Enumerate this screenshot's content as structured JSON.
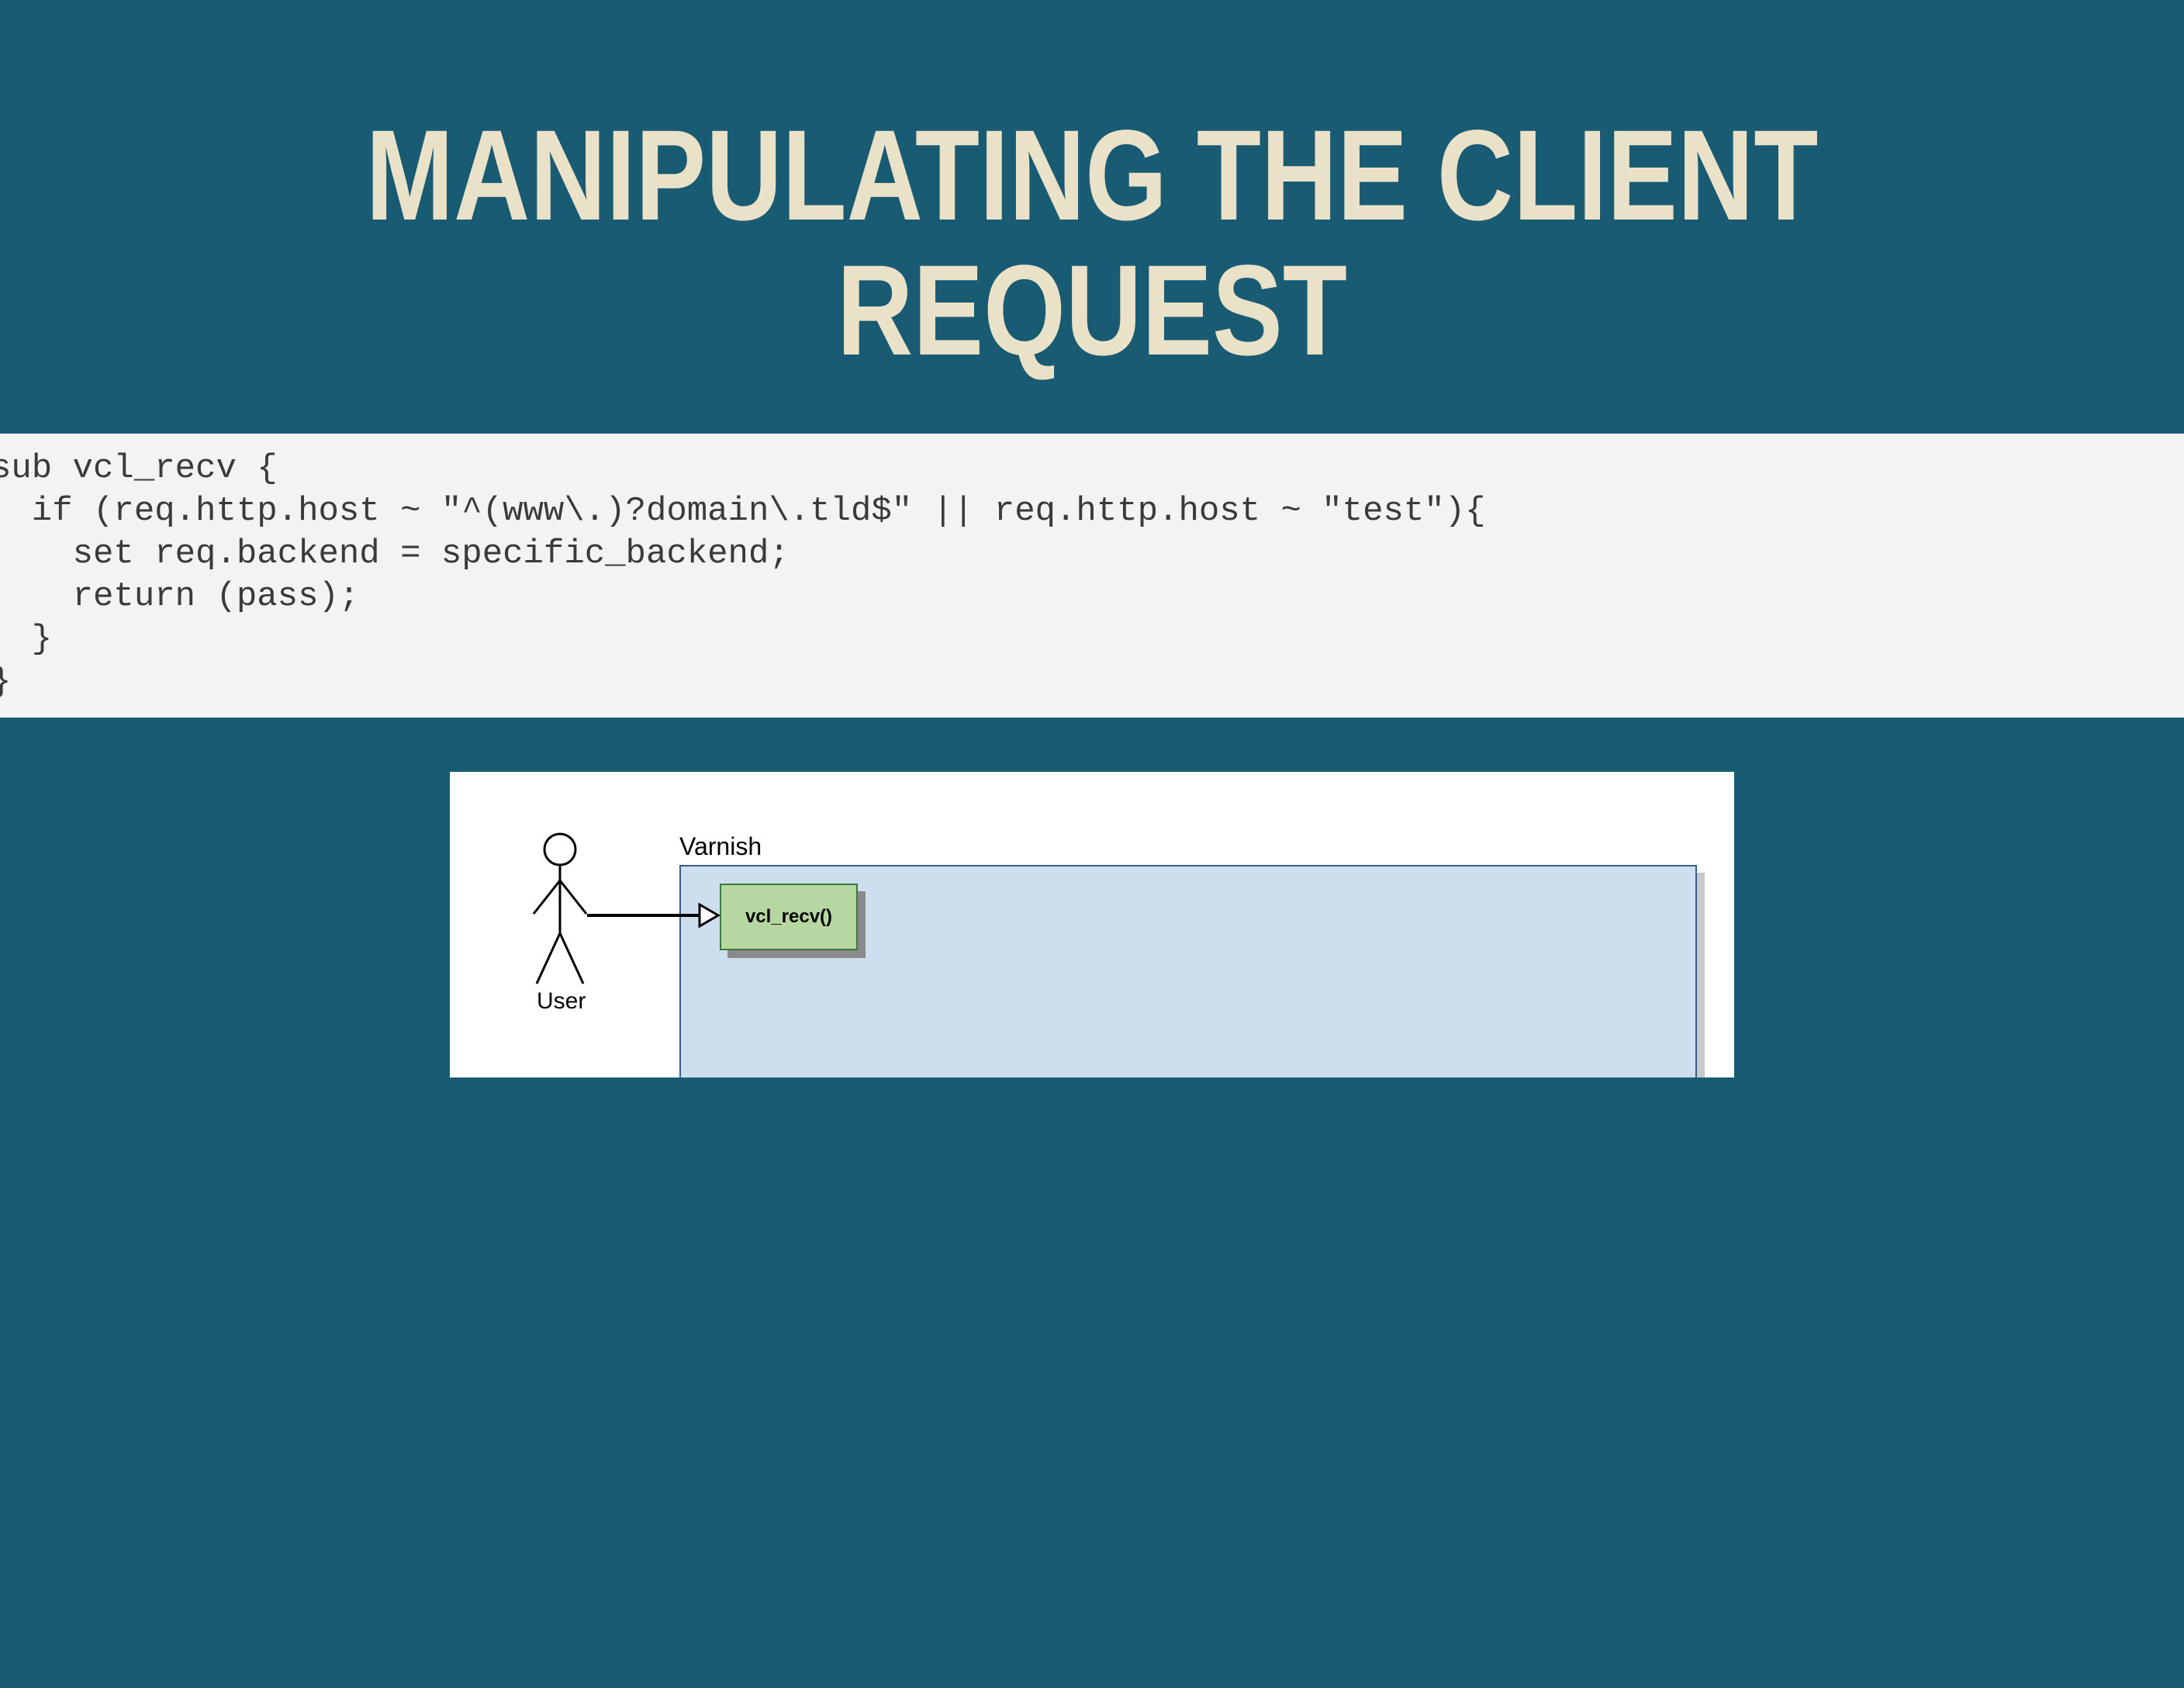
{
  "title": "MANIPULATING THE CLIENT REQUEST",
  "code": "sub vcl_recv {\n  if (req.http.host ~ \"^(www\\.)?domain\\.tld$\" || req.http.host ~ \"test\"){\n    set req.backend = specific_backend;\n    return (pass);\n  }\n}",
  "diagram": {
    "user_label": "User",
    "varnish_label": "Varnish",
    "vcl_box_label": "vcl_recv()"
  }
}
